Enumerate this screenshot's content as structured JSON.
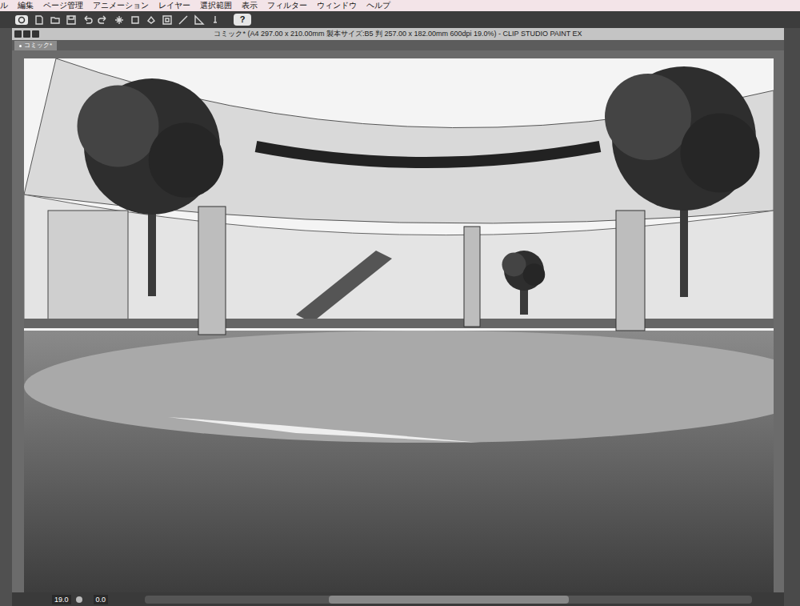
{
  "menu_bar": {
    "items": [
      {
        "label": "ル"
      },
      {
        "label": "編集"
      },
      {
        "label": "ページ管理"
      },
      {
        "label": "アニメーション"
      },
      {
        "label": "レイヤー"
      },
      {
        "label": "選択範囲"
      },
      {
        "label": "表示"
      },
      {
        "label": "フィルター"
      },
      {
        "label": "ウィンドウ"
      },
      {
        "label": "ヘルプ"
      }
    ]
  },
  "toolbar": {
    "help_button": "?"
  },
  "window": {
    "title": "コミック* (A4 297.00 x 210.00mm 製本サイズ:B5 判 257.00 x 182.00mm 600dpi 19.0%) - CLIP STUDIO PAINT EX"
  },
  "tabs": [
    {
      "label": "コミック*",
      "selected": true
    }
  ],
  "status_bar": {
    "zoom": "19.0",
    "rotation": "0.0"
  }
}
